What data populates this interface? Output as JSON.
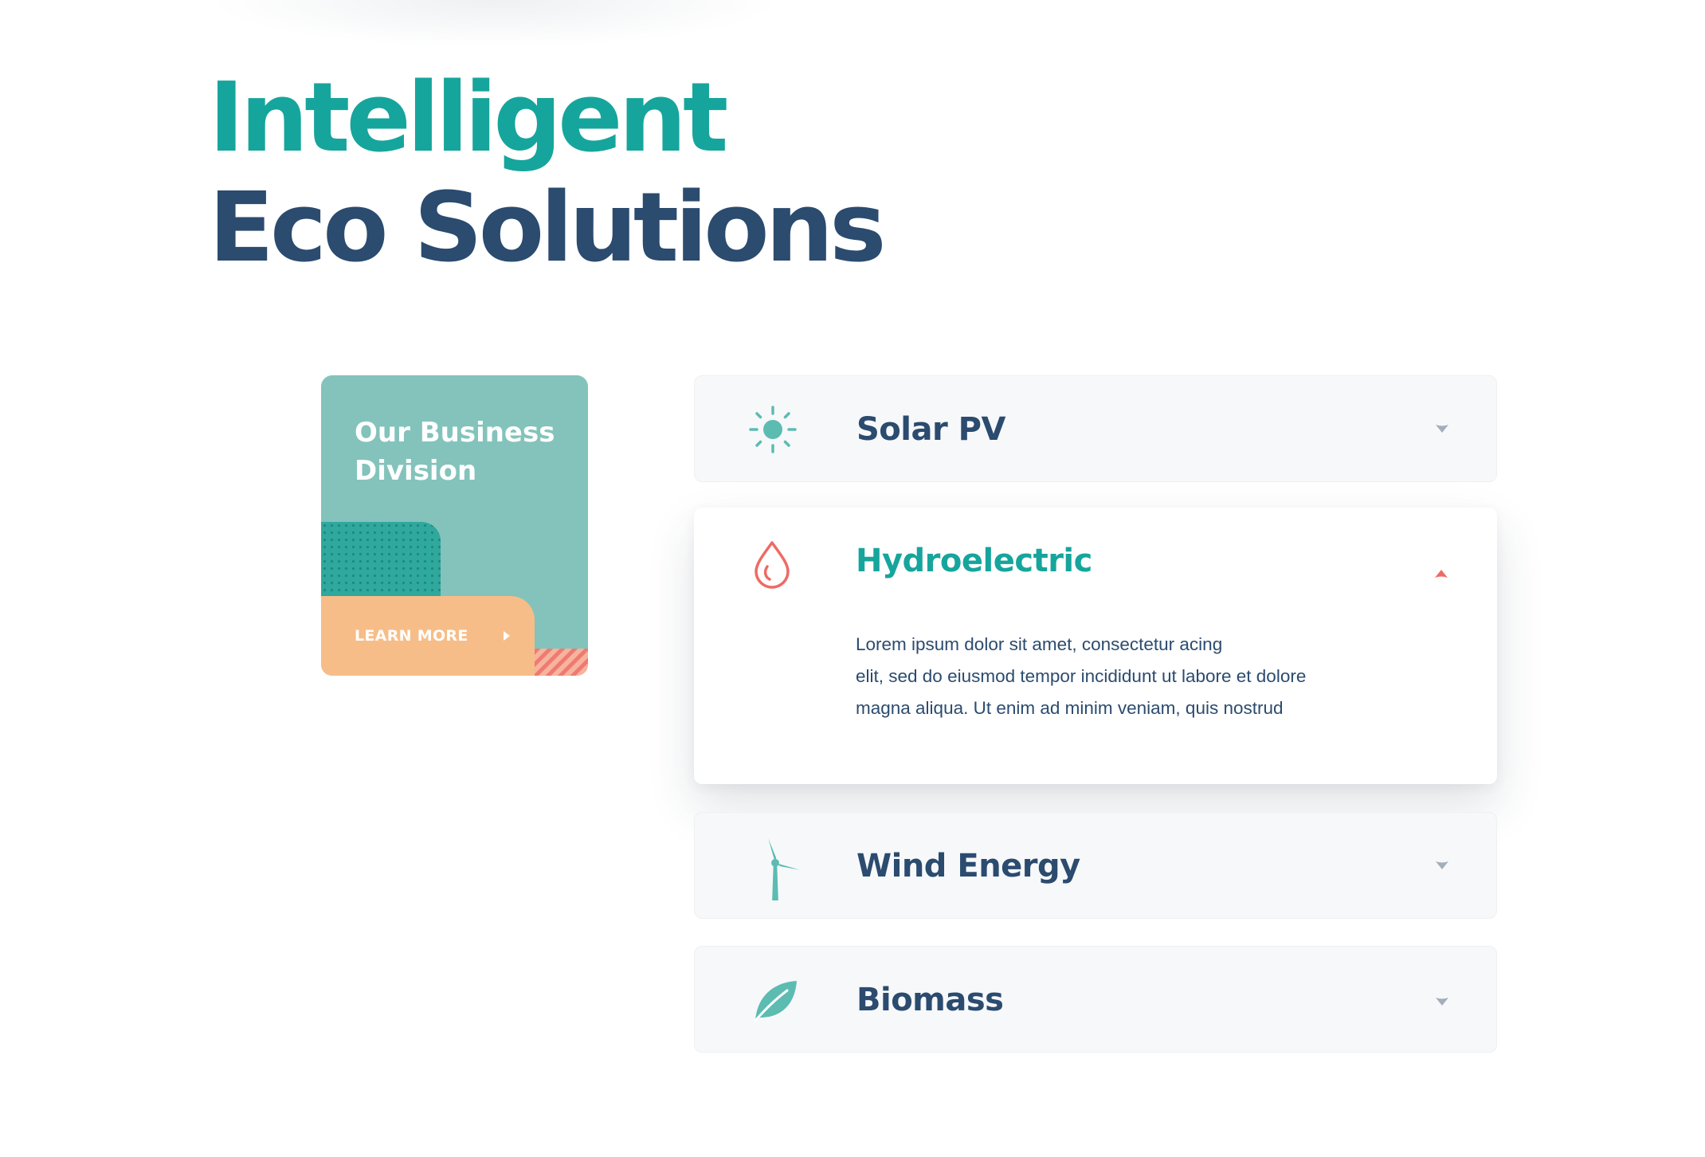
{
  "heading": {
    "line1": "Intelligent",
    "line2": "Eco Solutions"
  },
  "promo": {
    "title_line1": "Our Business",
    "title_line2": "Division",
    "button_label": "LEARN MORE"
  },
  "accordion": {
    "items": [
      {
        "title": "Solar PV",
        "icon": "sun-icon",
        "expanded": false
      },
      {
        "title": "Hydroelectric",
        "icon": "water-drop-icon",
        "expanded": true,
        "body": [
          "Lorem ipsum dolor sit amet, consectetur acing",
          "elit, sed do eiusmod tempor incididunt ut labore et dolore",
          "magna aliqua. Ut enim ad minim veniam, quis nostrud"
        ]
      },
      {
        "title": "Wind Energy",
        "icon": "wind-turbine-icon",
        "expanded": false
      },
      {
        "title": "Biomass",
        "icon": "leaf-icon",
        "expanded": false
      }
    ]
  },
  "colors": {
    "teal": "#16a59c",
    "navy": "#2b4b6f",
    "card_teal": "#83c3bb",
    "peach": "#f7bd88",
    "coral": "#ee6b63",
    "chevron_gray": "#a3aebb"
  }
}
